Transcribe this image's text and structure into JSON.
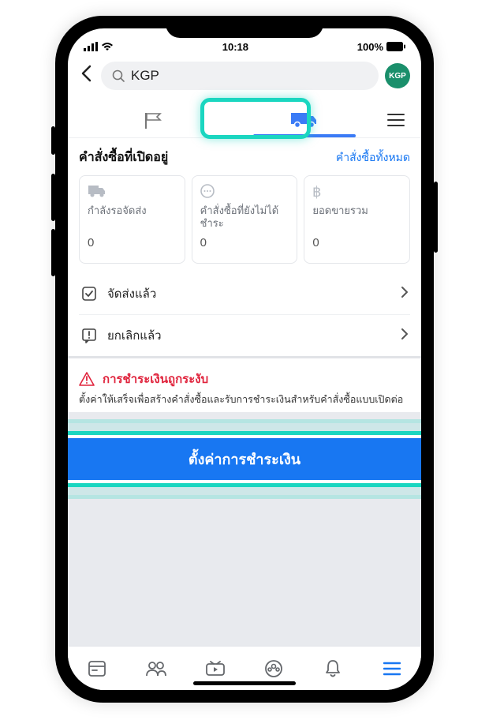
{
  "status": {
    "time": "10:18",
    "battery": "100%"
  },
  "header": {
    "search_value": "KGP",
    "avatar_label": "KGP"
  },
  "section": {
    "title": "คำสั่งซื้อที่เปิดอยู่",
    "link": "คำสั่งซื้อทั้งหมด",
    "stats": [
      {
        "label": "กำลังรอจัดส่ง",
        "value": "0"
      },
      {
        "label": "คำสั่งซื้อที่ยังไม่ได้ชำระ",
        "value": "0"
      },
      {
        "label": "ยอดขายรวม",
        "value": "0"
      }
    ]
  },
  "rows": {
    "shipped": "จัดส่งแล้ว",
    "cancelled": "ยกเลิกแล้ว"
  },
  "alert": {
    "title": "การชำระเงินถูกระงับ",
    "desc": "ตั้งค่าให้เสร็จเพื่อสร้างคำสั่งซื้อและรับการชำระเงินสำหรับคำสั่งซื้อแบบเปิดต่อ"
  },
  "cta": {
    "label": "ตั้งค่าการชำระเงิน"
  }
}
